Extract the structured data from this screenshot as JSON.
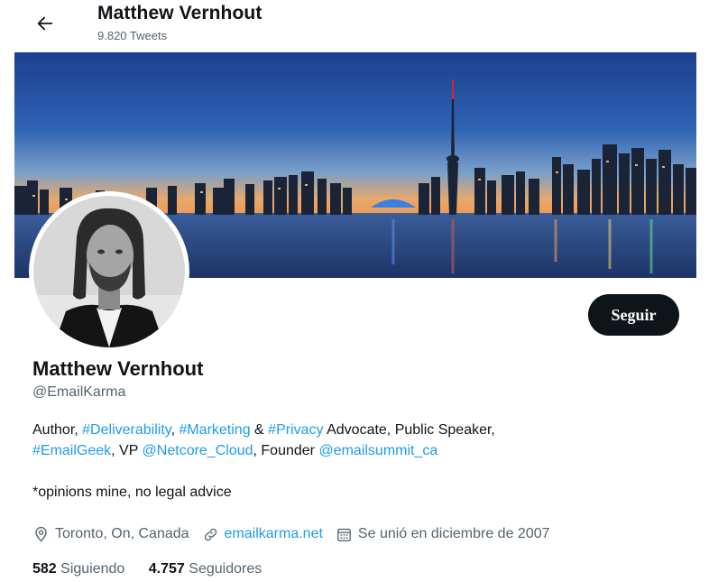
{
  "header": {
    "name": "Matthew Vernhout",
    "tweet_count": "9.820 Tweets",
    "back_icon": "arrow-left-icon"
  },
  "profile": {
    "name": "Matthew Vernhout",
    "handle": "@EmailKarma",
    "follow_label": "Seguir",
    "bio": {
      "t1": "Author, ",
      "h_deliverability": "#Deliverability",
      "t2": ", ",
      "h_marketing": "#Marketing",
      "t3": " & ",
      "h_privacy": "#Privacy",
      "t4": " Advocate, Public Speaker,",
      "h_emailgeek": "#EmailGeek",
      "t5": ", VP ",
      "m_netcore": "@Netcore_Cloud",
      "t6": ", Founder ",
      "m_emailsummit": "@emailsummit_ca",
      "note": "*opinions mine, no legal advice"
    },
    "location": "Toronto, On, Canada",
    "website": "emailkarma.net",
    "joined": "Se unió en diciembre de 2007",
    "following_count": "582",
    "following_label": " Siguiendo",
    "followers_count": "4.757",
    "followers_label": " Seguidores"
  },
  "icons": {
    "location": "location-pin-icon",
    "link": "link-icon",
    "calendar": "calendar-icon"
  },
  "colors": {
    "accent": "#1d9bf0",
    "text": "#0f1419",
    "secondary": "#536471",
    "button_bg": "#0f1419"
  }
}
